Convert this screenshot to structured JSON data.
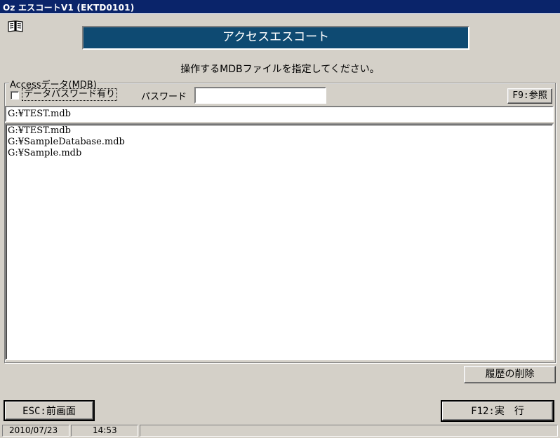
{
  "window": {
    "title": "Oz エスコートV1 (EKTD0101)"
  },
  "icons": {
    "manual": "open-book-icon"
  },
  "header": {
    "title": "アクセスエスコート"
  },
  "instruction": "操作するMDBファイルを指定してください。",
  "access_group": {
    "legend": "Accessデータ(MDB)",
    "password_checkbox": {
      "label": "データパスワード有り",
      "checked": false
    },
    "password_label": "パスワード",
    "password_value": "",
    "browse_button": "F9:参照",
    "current_path": "G:¥TEST.mdb",
    "history": [
      "G:¥TEST.mdb",
      "G:¥SampleDatabase.mdb",
      "G:¥Sample.mdb"
    ]
  },
  "clear_history_button": "履歴の削除",
  "back_button": "ESC:前画面",
  "execute_button": "F12:実　行",
  "statusbar": {
    "date": "2010/07/23",
    "time": "14:53"
  }
}
